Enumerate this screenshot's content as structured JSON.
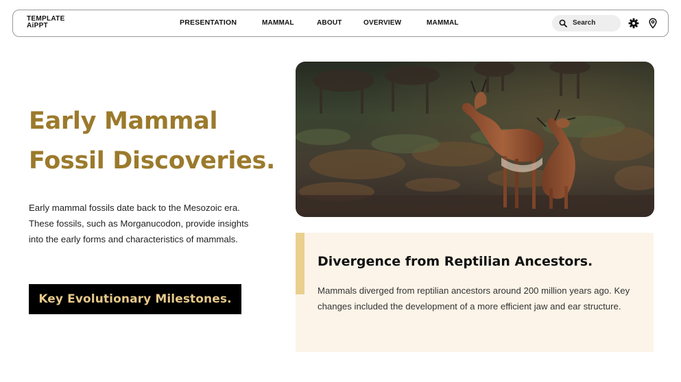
{
  "nav": {
    "brand_line1": "TEMPLATE",
    "brand_line2": "AiPPT",
    "links": [
      "PRESENTATION",
      "MAMMAL",
      "ABOUT",
      "OVERVIEW",
      "MAMMAL"
    ],
    "search_placeholder": "Search",
    "icons": [
      "search-icon",
      "gear-icon",
      "location-pin-icon"
    ]
  },
  "hero": {
    "title_line1": "Early Mammal",
    "title_line2": "Fossil Discoveries.",
    "description": "Early mammal fossils date back to the Mesozoic era. These fossils, such as Morganucodon, provide insights into the early forms and characteristics of mammals.",
    "cta_label": "Key Evolutionary Milestones."
  },
  "card": {
    "title": "Divergence from Reptilian Ancestors.",
    "text": "Mammals diverged from reptilian ancestors around 200 million years ago. Key changes included the development of a more efficient jaw and ear structure."
  },
  "colors": {
    "accent_gold": "#9b7a2c",
    "cta_text": "#e6c88a",
    "card_bg": "#fcf4e8",
    "card_accent": "#ead08f"
  }
}
